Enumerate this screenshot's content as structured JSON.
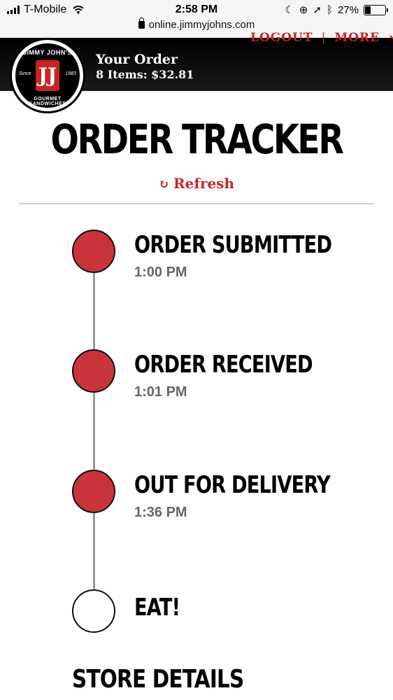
{
  "status_bar": {
    "carrier": "T-Mobile",
    "time": "2:58 PM",
    "battery": "27%",
    "battery_level": 0.27,
    "url": "online.jimmyjohns.com"
  },
  "header": {
    "logo_top_text": "JIMMY JOHN'S",
    "logo_bottom_text": "GOURMET SANDWICHES",
    "logo_since": "Since",
    "logo_year": "1983",
    "logo_mark": "JJ",
    "order_title": "Your Order",
    "order_summary": "8 Items: $32.81",
    "nav_logout": "LOGOUT",
    "nav_sep": "|",
    "nav_more": "MORE"
  },
  "main": {
    "title": "ORDER TRACKER",
    "refresh_label": "Refresh",
    "refresh_icon": "↻",
    "steps": [
      {
        "label": "ORDER SUBMITTED",
        "time": "1:00 PM",
        "status": "complete"
      },
      {
        "label": "ORDER RECEIVED",
        "time": "1:01 PM",
        "status": "complete"
      },
      {
        "label": "OUT FOR DELIVERY",
        "time": "1:36 PM",
        "status": "complete"
      },
      {
        "label": "EAT!",
        "time": "",
        "status": "pending"
      }
    ],
    "store_details": "STORE DETAILS"
  },
  "colors": {
    "accent": "#c8343a",
    "header_bg": "#000000"
  }
}
